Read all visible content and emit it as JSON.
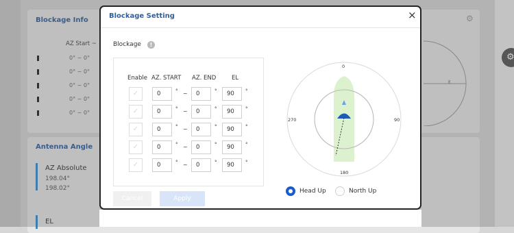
{
  "background": {
    "blockage_panel": {
      "title": "Blockage Info",
      "az_header": "AZ Start ~",
      "rows": [
        "0° ~ 0°",
        "0° ~ 0°",
        "0° ~ 0°",
        "0° ~ 0°",
        "0° ~ 0°"
      ]
    },
    "antenna_panel": {
      "title": "Antenna Angle",
      "az_label": "AZ Absolute",
      "az_values": [
        "198.04°",
        "198.02°"
      ],
      "el_label": "EL"
    },
    "polar_label": "E"
  },
  "modal": {
    "title": "Blockage Setting",
    "close_label": "×",
    "section_label": "Blockage",
    "info_label": "!",
    "columns": {
      "enable": "Enable",
      "az_start": "AZ. START",
      "az_end": "AZ. END",
      "el": "EL"
    },
    "rows": [
      {
        "az_start": "0",
        "az_end": "0",
        "el": "90"
      },
      {
        "az_start": "0",
        "az_end": "0",
        "el": "90"
      },
      {
        "az_start": "0",
        "az_end": "0",
        "el": "90"
      },
      {
        "az_start": "0",
        "az_end": "0",
        "el": "90"
      },
      {
        "az_start": "0",
        "az_end": "0",
        "el": "90"
      }
    ],
    "degree": "°",
    "tilde": "~",
    "cancel_label": "Cancel",
    "apply_label": "Apply",
    "compass": {
      "n": "0",
      "e": "90",
      "s": "180",
      "w": "270"
    },
    "orientation": {
      "head_up": "Head Up",
      "north_up": "North Up",
      "selected": "head_up"
    }
  },
  "colors": {
    "accent": "#1a5cc8",
    "title": "#2e5f9e",
    "ship": "#d6efc4",
    "antenna": "#1d5bb6"
  }
}
